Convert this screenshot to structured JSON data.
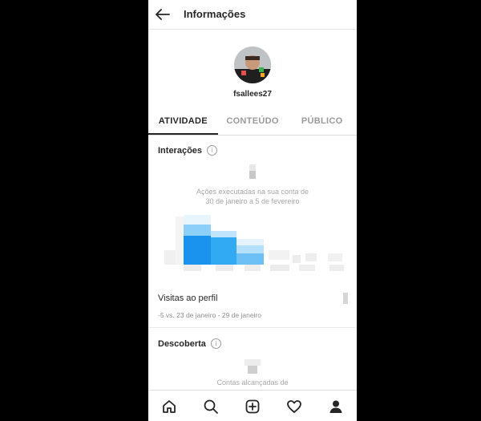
{
  "header": {
    "title": "Informações",
    "back_icon": "arrow-left-icon"
  },
  "profile": {
    "username": "fsallees27"
  },
  "tabs": [
    {
      "label": "ATIVIDADE",
      "active": true
    },
    {
      "label": "CONTEÚDO",
      "active": false
    },
    {
      "label": "PÚBLICO",
      "active": false
    }
  ],
  "interactions": {
    "title": "Interações",
    "info_icon": "info-icon",
    "caption_line1": "Ações executadas na sua conta de",
    "caption_line2": "30 de janeiro a 5 de fevereiro"
  },
  "profile_visits": {
    "label": "Visitas ao perfil",
    "subtitle": "-5 vs. 23 de janeiro - 29 de janeiro"
  },
  "discovery": {
    "title": "Descoberta",
    "caption": "Contas alcançadas de"
  },
  "bottom_nav": [
    {
      "name": "home-icon"
    },
    {
      "name": "search-icon"
    },
    {
      "name": "new-post-icon"
    },
    {
      "name": "heart-icon"
    },
    {
      "name": "profile-icon"
    }
  ],
  "colors": {
    "accent_blue": "#0095f6",
    "light_blue": "#64c3f7"
  }
}
